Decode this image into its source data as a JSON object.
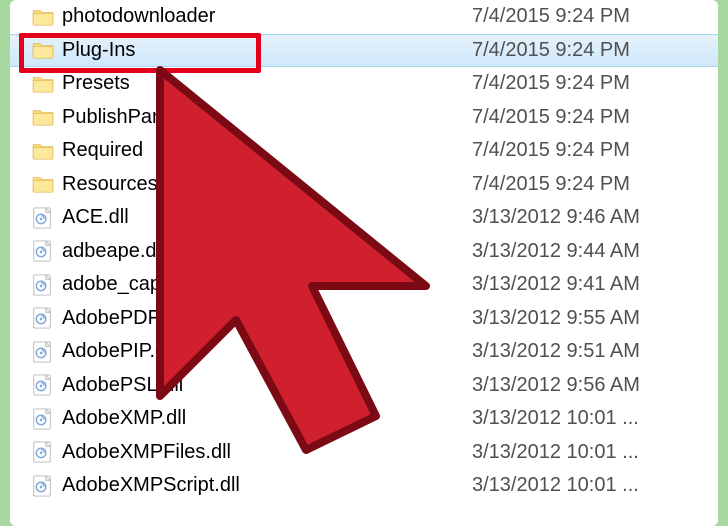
{
  "files": [
    {
      "name": "photodownloader",
      "date": "7/4/2015 9:24 PM",
      "type": "folder",
      "selected": false
    },
    {
      "name": "Plug-Ins",
      "date": "7/4/2015 9:24 PM",
      "type": "folder",
      "selected": true
    },
    {
      "name": "Presets",
      "date": "7/4/2015 9:24 PM",
      "type": "folder",
      "selected": false
    },
    {
      "name": "PublishPanel",
      "date": "7/4/2015 9:24 PM",
      "type": "folder",
      "selected": false
    },
    {
      "name": "Required",
      "date": "7/4/2015 9:24 PM",
      "type": "folder",
      "selected": false
    },
    {
      "name": "Resources",
      "date": "7/4/2015 9:24 PM",
      "type": "folder",
      "selected": false
    },
    {
      "name": "ACE.dll",
      "date": "3/13/2012 9:46 AM",
      "type": "dll",
      "selected": false
    },
    {
      "name": "adbeape.dll",
      "date": "3/13/2012 9:44 AM",
      "type": "dll",
      "selected": false
    },
    {
      "name": "adobe_caps.dll",
      "date": "3/13/2012 9:41 AM",
      "type": "dll",
      "selected": false
    },
    {
      "name": "AdobePDFL.dll",
      "date": "3/13/2012 9:55 AM",
      "type": "dll",
      "selected": false
    },
    {
      "name": "AdobePIP.dll",
      "date": "3/13/2012 9:51 AM",
      "type": "dll",
      "selected": false
    },
    {
      "name": "AdobePSL.dll",
      "date": "3/13/2012 9:56 AM",
      "type": "dll",
      "selected": false
    },
    {
      "name": "AdobeXMP.dll",
      "date": "3/13/2012 10:01 ...",
      "type": "dll",
      "selected": false
    },
    {
      "name": "AdobeXMPFiles.dll",
      "date": "3/13/2012 10:01 ...",
      "type": "dll",
      "selected": false
    },
    {
      "name": "AdobeXMPScript.dll",
      "date": "3/13/2012 10:01 ...",
      "type": "dll",
      "selected": false
    }
  ]
}
